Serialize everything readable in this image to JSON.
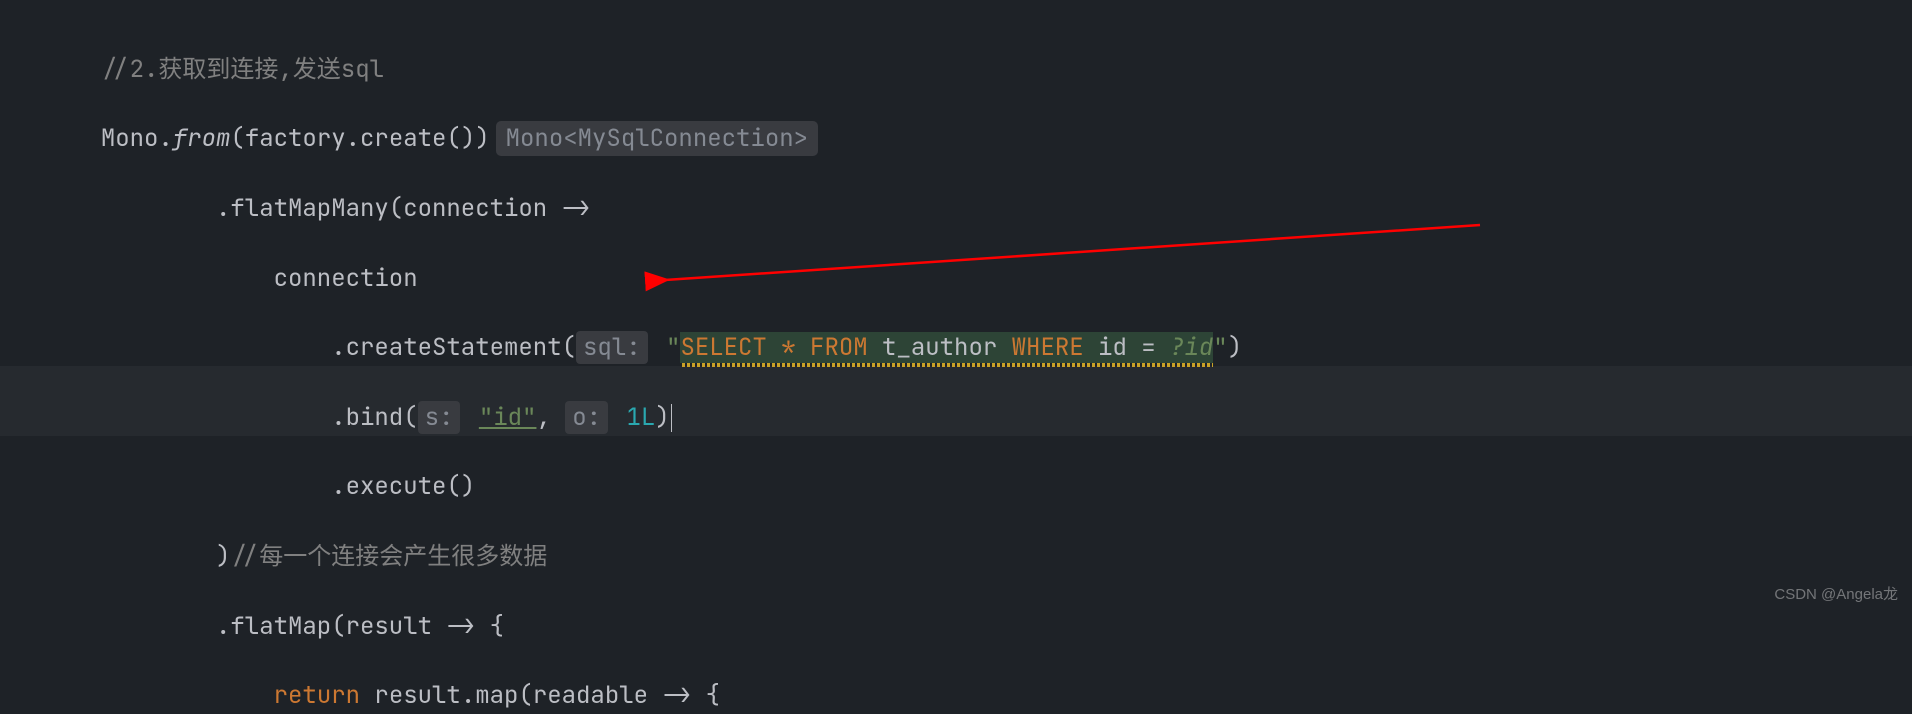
{
  "code": {
    "line1_comment": "//2.获取到连接,发送sql",
    "line2_mono": "Mono.",
    "line2_from": "from",
    "line2_args": "(factory.create())",
    "line2_hint": "Mono<MySqlConnection>",
    "line3_flatMapMany": "        .flatMapMany(connection ->",
    "line4_connection": "            connection",
    "line5_createStatement": "                .createStatement(",
    "line5_sql_hint": "sql:",
    "line5_sql_open": "\"",
    "line5_sql_select": "SELECT",
    "line5_sql_star": " * ",
    "line5_sql_from": "FROM",
    "line5_sql_table": " t_author ",
    "line5_sql_where": "WHERE",
    "line5_sql_id": " id ",
    "line5_sql_eq": "= ",
    "line5_sql_param": "?id",
    "line5_sql_close": "\"",
    "line5_close_paren": ")",
    "line6_bind": "                .bind(",
    "line6_s_hint": "s:",
    "line6_id_str": "\"id\"",
    "line6_comma": ", ",
    "line6_o_hint": "o:",
    "line6_1L": "1L",
    "line6_close": ")",
    "line7_execute": "                .execute()",
    "line8_close_comment": "        )//每一个连接会产生很多数据",
    "line9_flatMap": "        .flatMap(result -> {",
    "line10_return_kw": "return",
    "line10_rest": " result.map(readable -> {"
  },
  "watermark": "CSDN @Angela龙"
}
